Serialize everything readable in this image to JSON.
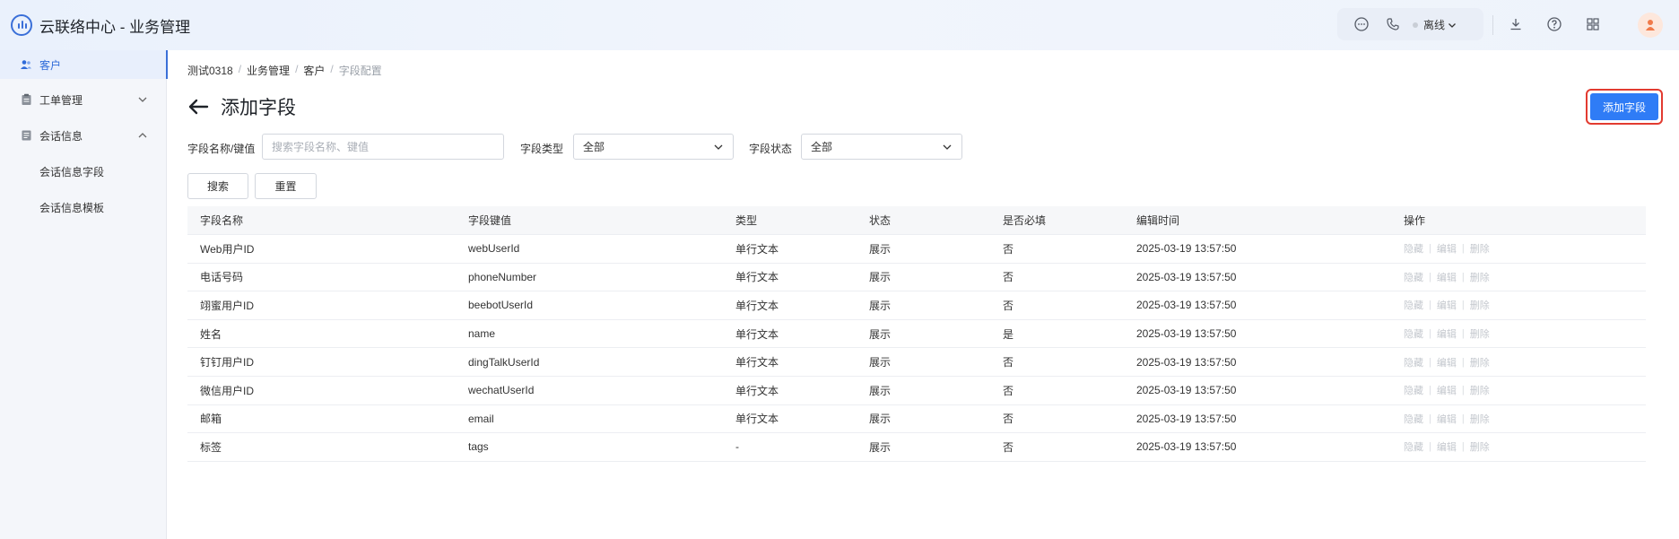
{
  "header": {
    "app_title": "云联络中心 - 业务管理",
    "status": "离线",
    "icons": [
      "chat-icon",
      "phone-icon",
      "chevron-down-icon",
      "download-icon",
      "help-icon",
      "apps-grid-icon",
      "avatar"
    ]
  },
  "sidebar": {
    "items": [
      {
        "label": "客户",
        "icon": "users-icon",
        "active": true
      },
      {
        "label": "工单管理",
        "icon": "clipboard-icon",
        "expanded": false
      },
      {
        "label": "会话信息",
        "icon": "session-icon",
        "expanded": true
      }
    ],
    "sub_items": [
      "会话信息字段",
      "会话信息模板"
    ]
  },
  "breadcrumb": [
    "测试0318",
    "业务管理",
    "客户",
    "字段配置"
  ],
  "page": {
    "title": "添加字段",
    "add_button": "添加字段"
  },
  "filters": {
    "name_label": "字段名称/键值",
    "name_placeholder": "搜索字段名称、键值",
    "type_label": "字段类型",
    "type_value": "全部",
    "status_label": "字段状态",
    "status_value": "全部",
    "search_button": "搜索",
    "reset_button": "重置"
  },
  "table": {
    "columns": [
      "字段名称",
      "字段键值",
      "类型",
      "状态",
      "是否必填",
      "编辑时间",
      "操作"
    ],
    "actions": [
      "隐藏",
      "编辑",
      "删除"
    ],
    "rows": [
      {
        "name": "Web用户ID",
        "key": "webUserId",
        "type": "单行文本",
        "status": "展示",
        "required": "否",
        "time": "2025-03-19 13:57:50"
      },
      {
        "name": "电话号码",
        "key": "phoneNumber",
        "type": "单行文本",
        "status": "展示",
        "required": "否",
        "time": "2025-03-19 13:57:50"
      },
      {
        "name": "翊蜜用户ID",
        "key": "beebotUserId",
        "type": "单行文本",
        "status": "展示",
        "required": "否",
        "time": "2025-03-19 13:57:50"
      },
      {
        "name": "姓名",
        "key": "name",
        "type": "单行文本",
        "status": "展示",
        "required": "是",
        "time": "2025-03-19 13:57:50"
      },
      {
        "name": "钉钉用户ID",
        "key": "dingTalkUserId",
        "type": "单行文本",
        "status": "展示",
        "required": "否",
        "time": "2025-03-19 13:57:50"
      },
      {
        "name": "微信用户ID",
        "key": "wechatUserId",
        "type": "单行文本",
        "status": "展示",
        "required": "否",
        "time": "2025-03-19 13:57:50"
      },
      {
        "name": "邮箱",
        "key": "email",
        "type": "单行文本",
        "status": "展示",
        "required": "否",
        "time": "2025-03-19 13:57:50"
      },
      {
        "name": "标签",
        "key": "tags",
        "type": "-",
        "status": "展示",
        "required": "否",
        "time": "2025-03-19 13:57:50"
      }
    ]
  }
}
